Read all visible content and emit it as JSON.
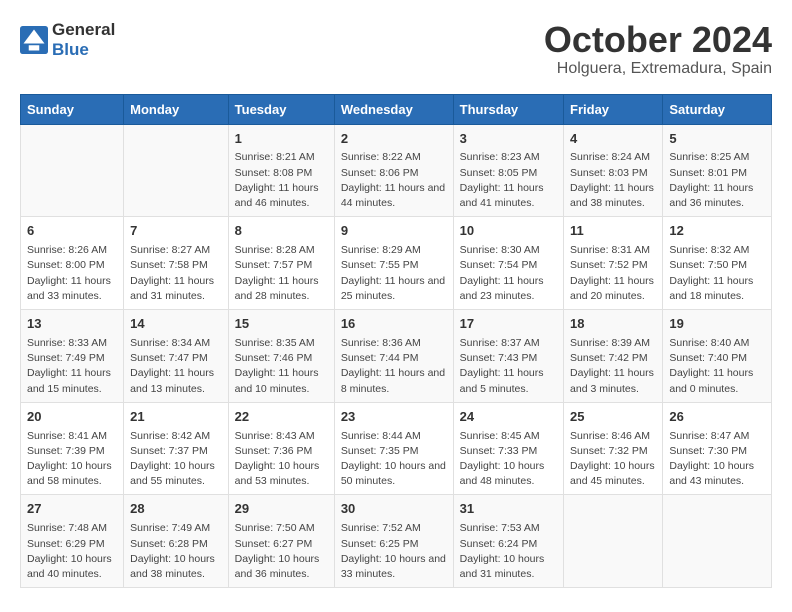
{
  "logo": {
    "general": "General",
    "blue": "Blue"
  },
  "title": "October 2024",
  "subtitle": "Holguera, Extremadura, Spain",
  "days_of_week": [
    "Sunday",
    "Monday",
    "Tuesday",
    "Wednesday",
    "Thursday",
    "Friday",
    "Saturday"
  ],
  "weeks": [
    [
      {
        "day": "",
        "content": ""
      },
      {
        "day": "",
        "content": ""
      },
      {
        "day": "1",
        "content": "Sunrise: 8:21 AM\nSunset: 8:08 PM\nDaylight: 11 hours and 46 minutes."
      },
      {
        "day": "2",
        "content": "Sunrise: 8:22 AM\nSunset: 8:06 PM\nDaylight: 11 hours and 44 minutes."
      },
      {
        "day": "3",
        "content": "Sunrise: 8:23 AM\nSunset: 8:05 PM\nDaylight: 11 hours and 41 minutes."
      },
      {
        "day": "4",
        "content": "Sunrise: 8:24 AM\nSunset: 8:03 PM\nDaylight: 11 hours and 38 minutes."
      },
      {
        "day": "5",
        "content": "Sunrise: 8:25 AM\nSunset: 8:01 PM\nDaylight: 11 hours and 36 minutes."
      }
    ],
    [
      {
        "day": "6",
        "content": "Sunrise: 8:26 AM\nSunset: 8:00 PM\nDaylight: 11 hours and 33 minutes."
      },
      {
        "day": "7",
        "content": "Sunrise: 8:27 AM\nSunset: 7:58 PM\nDaylight: 11 hours and 31 minutes."
      },
      {
        "day": "8",
        "content": "Sunrise: 8:28 AM\nSunset: 7:57 PM\nDaylight: 11 hours and 28 minutes."
      },
      {
        "day": "9",
        "content": "Sunrise: 8:29 AM\nSunset: 7:55 PM\nDaylight: 11 hours and 25 minutes."
      },
      {
        "day": "10",
        "content": "Sunrise: 8:30 AM\nSunset: 7:54 PM\nDaylight: 11 hours and 23 minutes."
      },
      {
        "day": "11",
        "content": "Sunrise: 8:31 AM\nSunset: 7:52 PM\nDaylight: 11 hours and 20 minutes."
      },
      {
        "day": "12",
        "content": "Sunrise: 8:32 AM\nSunset: 7:50 PM\nDaylight: 11 hours and 18 minutes."
      }
    ],
    [
      {
        "day": "13",
        "content": "Sunrise: 8:33 AM\nSunset: 7:49 PM\nDaylight: 11 hours and 15 minutes."
      },
      {
        "day": "14",
        "content": "Sunrise: 8:34 AM\nSunset: 7:47 PM\nDaylight: 11 hours and 13 minutes."
      },
      {
        "day": "15",
        "content": "Sunrise: 8:35 AM\nSunset: 7:46 PM\nDaylight: 11 hours and 10 minutes."
      },
      {
        "day": "16",
        "content": "Sunrise: 8:36 AM\nSunset: 7:44 PM\nDaylight: 11 hours and 8 minutes."
      },
      {
        "day": "17",
        "content": "Sunrise: 8:37 AM\nSunset: 7:43 PM\nDaylight: 11 hours and 5 minutes."
      },
      {
        "day": "18",
        "content": "Sunrise: 8:39 AM\nSunset: 7:42 PM\nDaylight: 11 hours and 3 minutes."
      },
      {
        "day": "19",
        "content": "Sunrise: 8:40 AM\nSunset: 7:40 PM\nDaylight: 11 hours and 0 minutes."
      }
    ],
    [
      {
        "day": "20",
        "content": "Sunrise: 8:41 AM\nSunset: 7:39 PM\nDaylight: 10 hours and 58 minutes."
      },
      {
        "day": "21",
        "content": "Sunrise: 8:42 AM\nSunset: 7:37 PM\nDaylight: 10 hours and 55 minutes."
      },
      {
        "day": "22",
        "content": "Sunrise: 8:43 AM\nSunset: 7:36 PM\nDaylight: 10 hours and 53 minutes."
      },
      {
        "day": "23",
        "content": "Sunrise: 8:44 AM\nSunset: 7:35 PM\nDaylight: 10 hours and 50 minutes."
      },
      {
        "day": "24",
        "content": "Sunrise: 8:45 AM\nSunset: 7:33 PM\nDaylight: 10 hours and 48 minutes."
      },
      {
        "day": "25",
        "content": "Sunrise: 8:46 AM\nSunset: 7:32 PM\nDaylight: 10 hours and 45 minutes."
      },
      {
        "day": "26",
        "content": "Sunrise: 8:47 AM\nSunset: 7:30 PM\nDaylight: 10 hours and 43 minutes."
      }
    ],
    [
      {
        "day": "27",
        "content": "Sunrise: 7:48 AM\nSunset: 6:29 PM\nDaylight: 10 hours and 40 minutes."
      },
      {
        "day": "28",
        "content": "Sunrise: 7:49 AM\nSunset: 6:28 PM\nDaylight: 10 hours and 38 minutes."
      },
      {
        "day": "29",
        "content": "Sunrise: 7:50 AM\nSunset: 6:27 PM\nDaylight: 10 hours and 36 minutes."
      },
      {
        "day": "30",
        "content": "Sunrise: 7:52 AM\nSunset: 6:25 PM\nDaylight: 10 hours and 33 minutes."
      },
      {
        "day": "31",
        "content": "Sunrise: 7:53 AM\nSunset: 6:24 PM\nDaylight: 10 hours and 31 minutes."
      },
      {
        "day": "",
        "content": ""
      },
      {
        "day": "",
        "content": ""
      }
    ]
  ]
}
